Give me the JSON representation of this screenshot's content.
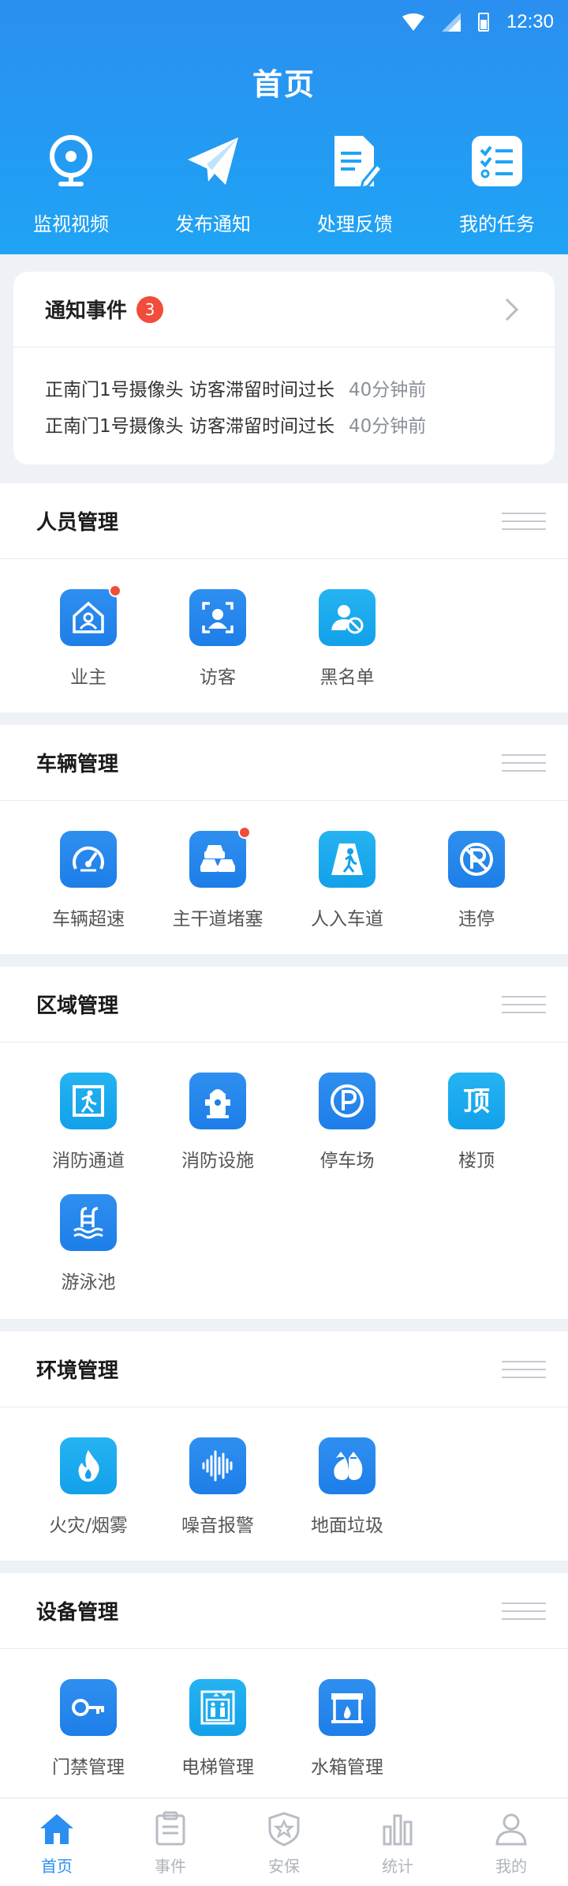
{
  "status_bar": {
    "time": "12:30"
  },
  "header": {
    "title": "首页",
    "quick_actions": [
      {
        "label": "监视视频",
        "icon": "camera-icon"
      },
      {
        "label": "发布通知",
        "icon": "paper-plane-icon"
      },
      {
        "label": "处理反馈",
        "icon": "document-edit-icon"
      },
      {
        "label": "我的任务",
        "icon": "task-list-icon"
      }
    ]
  },
  "notify": {
    "title": "通知事件",
    "count": "3",
    "items": [
      {
        "message": "正南门1号摄像头 访客滞留时间过长",
        "ago": "40分钟前"
      },
      {
        "message": "正南门1号摄像头 访客滞留时间过长",
        "ago": "40分钟前"
      }
    ]
  },
  "sections": {
    "personnel": {
      "title": "人员管理",
      "items": [
        {
          "label": "业主",
          "icon": "home-user-icon",
          "dot": true
        },
        {
          "label": "访客",
          "icon": "visitor-icon"
        },
        {
          "label": "黑名单",
          "icon": "blocked-user-icon"
        }
      ]
    },
    "vehicle": {
      "title": "车辆管理",
      "items": [
        {
          "label": "车辆超速",
          "icon": "speedometer-icon"
        },
        {
          "label": "主干道堵塞",
          "icon": "traffic-jam-icon",
          "dot": true
        },
        {
          "label": "人入车道",
          "icon": "pedestrian-road-icon"
        },
        {
          "label": "违停",
          "icon": "no-parking-icon"
        }
      ]
    },
    "area": {
      "title": "区域管理",
      "items": [
        {
          "label": "消防通道",
          "icon": "emergency-exit-icon"
        },
        {
          "label": "消防设施",
          "icon": "fire-hydrant-icon"
        },
        {
          "label": "停车场",
          "icon": "parking-icon"
        },
        {
          "label": "楼顶",
          "icon": "rooftop-icon",
          "glyph": "顶"
        },
        {
          "label": "游泳池",
          "icon": "swimming-pool-icon"
        }
      ]
    },
    "environment": {
      "title": "环境管理",
      "items": [
        {
          "label": "火灾/烟雾",
          "icon": "fire-icon"
        },
        {
          "label": "噪音报警",
          "icon": "sound-wave-icon"
        },
        {
          "label": "地面垃圾",
          "icon": "garbage-bag-icon"
        }
      ]
    },
    "equipment": {
      "title": "设备管理",
      "items": [
        {
          "label": "门禁管理",
          "icon": "key-icon"
        },
        {
          "label": "电梯管理",
          "icon": "elevator-icon"
        },
        {
          "label": "水箱管理",
          "icon": "water-tank-icon"
        }
      ]
    }
  },
  "tabbar": {
    "items": [
      {
        "label": "首页",
        "icon": "home-icon",
        "active": true
      },
      {
        "label": "事件",
        "icon": "clipboard-icon"
      },
      {
        "label": "安保",
        "icon": "shield-icon"
      },
      {
        "label": "统计",
        "icon": "bar-chart-icon"
      },
      {
        "label": "我的",
        "icon": "user-icon"
      }
    ]
  },
  "colors": {
    "primary": "#2a8ff0",
    "badge": "#f24c3a",
    "cyan": "#12a1ea"
  }
}
